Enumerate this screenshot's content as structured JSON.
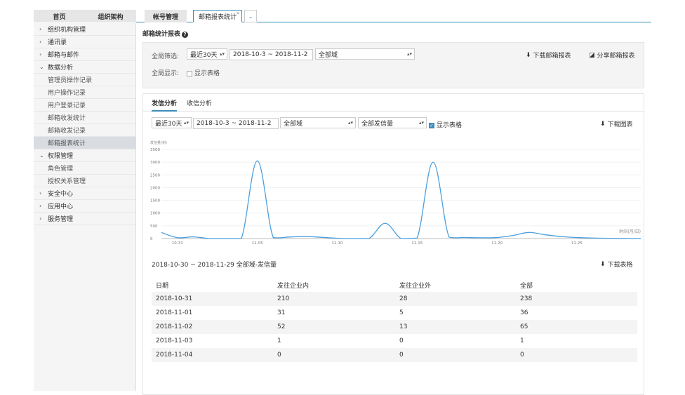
{
  "topnav": {
    "home": "首页",
    "org": "组织架构"
  },
  "tabs": {
    "account": "帐号管理",
    "active": "邮箱报表统计",
    "close": "×",
    "dropdown": "⌄"
  },
  "sidebar": {
    "items": [
      {
        "label": "组织机构管理",
        "arrow": "›"
      },
      {
        "label": "通讯录",
        "arrow": "›"
      },
      {
        "label": "邮箱与邮件",
        "arrow": "›"
      },
      {
        "label": "数据分析",
        "arrow": "⌄"
      },
      {
        "label": "管理员操作记录"
      },
      {
        "label": "用户操作记录"
      },
      {
        "label": "用户登录记录"
      },
      {
        "label": "邮箱收发统计"
      },
      {
        "label": "邮箱收发记录"
      },
      {
        "label": "邮箱报表统计"
      },
      {
        "label": "权限管理",
        "arrow": "⌄"
      },
      {
        "label": "角色管理"
      },
      {
        "label": "授权关系管理"
      },
      {
        "label": "安全中心",
        "arrow": "›"
      },
      {
        "label": "应用中心",
        "arrow": "›"
      },
      {
        "label": "服务管理",
        "arrow": "›"
      }
    ]
  },
  "page": {
    "title": "邮箱统计报表",
    "help_icon": "question-circle-icon"
  },
  "filters": {
    "global_filter_label": "全局筛选:",
    "range_select": "最近30天",
    "date_range": "2018-10-3 ~ 2018-11-2",
    "domain_select": "全部域",
    "global_display_label": "全局显示:",
    "show_table_label": "显示表格",
    "download_report": "下载邮箱报表",
    "share_report": "分享邮箱报表"
  },
  "subtabs": {
    "send": "发信分析",
    "receive": "收信分析"
  },
  "chart_controls": {
    "range_select": "最近30天",
    "date_range": "2018-10-3 ~ 2018-11-2",
    "domain_select": "全部域",
    "volume_select": "全部发信量",
    "show_table_label": "显示表格",
    "download_chart": "下载图表"
  },
  "chart_data": {
    "type": "line",
    "ylabel": "发信量(封)",
    "xlabel": "时间(月/日)",
    "ylim": [
      0,
      3500
    ],
    "yticks": [
      0,
      500,
      1000,
      1500,
      2000,
      2500,
      3000,
      3500
    ],
    "xticks": [
      "10-31",
      "11-05",
      "11-10",
      "11-15",
      "11-20",
      "11-25"
    ],
    "x": [
      "10-30",
      "10-31",
      "11-01",
      "11-02",
      "11-03",
      "11-04",
      "11-05",
      "11-06",
      "11-07",
      "11-08",
      "11-09",
      "11-10",
      "11-11",
      "11-12",
      "11-13",
      "11-14",
      "11-15",
      "11-16",
      "11-17",
      "11-18",
      "11-19",
      "11-20",
      "11-21",
      "11-22",
      "11-23",
      "11-24",
      "11-25",
      "11-26",
      "11-27",
      "11-28",
      "11-29"
    ],
    "values": [
      238,
      36,
      65,
      1,
      0,
      0,
      3050,
      40,
      60,
      80,
      50,
      10,
      0,
      5,
      600,
      0,
      20,
      3000,
      60,
      40,
      30,
      40,
      120,
      240,
      150,
      80,
      40,
      20,
      10,
      5,
      0
    ],
    "color": "#4a9fe0"
  },
  "table": {
    "title": "2018-10-30 ~ 2018-11-29 全部域-发信量",
    "download": "下载表格",
    "headers": [
      "日期",
      "发往企业内",
      "发往企业外",
      "全部"
    ],
    "rows": [
      [
        "2018-10-31",
        "210",
        "28",
        "238"
      ],
      [
        "2018-11-01",
        "31",
        "5",
        "36"
      ],
      [
        "2018-11-02",
        "52",
        "13",
        "65"
      ],
      [
        "2018-11-03",
        "1",
        "0",
        "1"
      ],
      [
        "2018-11-04",
        "0",
        "0",
        "0"
      ]
    ]
  }
}
